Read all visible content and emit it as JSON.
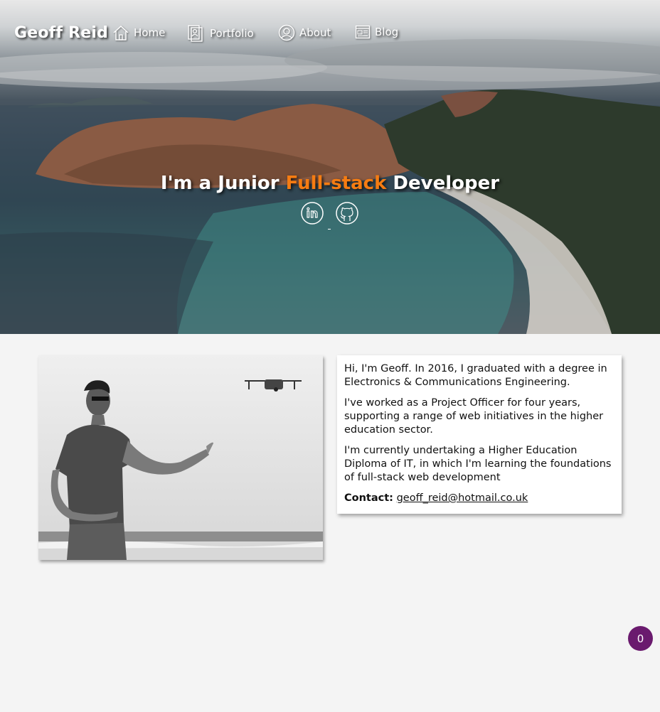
{
  "nav": {
    "brand": "Geoff Reid",
    "items": [
      {
        "label": "Home",
        "icon": "home-icon"
      },
      {
        "label": "Portfolio",
        "icon": "portfolio-icon"
      },
      {
        "label": "About",
        "icon": "user-icon"
      },
      {
        "label": "Blog",
        "icon": "blog-icon"
      }
    ]
  },
  "hero": {
    "headline_pre": "I'm a Junior ",
    "headline_accent": "Full-stack",
    "headline_post": " Developer",
    "accent_color": "#f57c12",
    "social": [
      {
        "icon": "linkedin-icon"
      },
      {
        "icon": "github-icon"
      }
    ]
  },
  "about": {
    "paragraphs": [
      "Hi, I'm Geoff. In 2016, I graduated with a degree in Electronics & Communications Engineering.",
      "I've worked as a Project Officer for four years, supporting a range of web initiatives in the higher education sector.",
      "I'm currently undertaking a Higher Education Diploma of IT, in which I'm learning the foundations of full-stack web development"
    ],
    "contact_label": "Contact:",
    "contact_email": "geoff_reid@hotmail.co.uk"
  },
  "counter": {
    "value": "0",
    "color": "#6a1a6e"
  }
}
